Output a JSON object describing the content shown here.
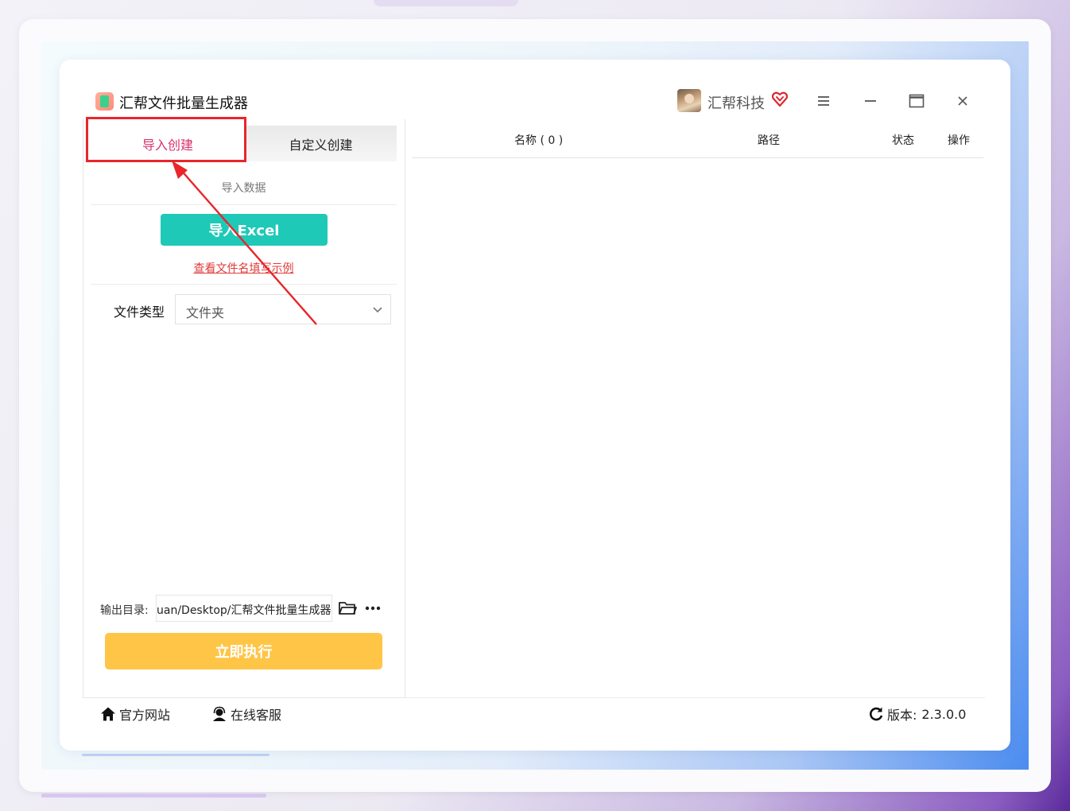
{
  "app": {
    "title": "汇帮文件批量生成器",
    "company": "汇帮科技"
  },
  "tabs": [
    {
      "label": "导入创建",
      "active": true
    },
    {
      "label": "自定义创建",
      "active": false
    }
  ],
  "import_section": {
    "label": "导入数据",
    "import_button": "导入Excel",
    "example_link": "查看文件名填写示例"
  },
  "file_type": {
    "label": "文件类型",
    "selected": "文件夹"
  },
  "output": {
    "label": "输出目录:",
    "path": "uan/Desktop/汇帮文件批量生成器"
  },
  "execute_button": "立即执行",
  "table": {
    "columns": [
      "名称 ( 0 )",
      "路径",
      "状态",
      "操作"
    ],
    "rows": []
  },
  "footer": {
    "website": "官方网站",
    "support": "在线客服",
    "version_label": "版本:",
    "version": "2.3.0.0"
  },
  "colors": {
    "accent_teal": "#1ec9b7",
    "execute_yellow": "#ffc547",
    "active_tab_pink": "#d6336c",
    "highlight_red": "#e8262b"
  },
  "icons": [
    "vip-heart-icon",
    "menu-icon",
    "minimize-icon",
    "maximize-icon",
    "close-icon",
    "chevron-down-icon",
    "folder-open-icon",
    "more-icon",
    "home-icon",
    "support-agent-icon",
    "refresh-icon"
  ]
}
